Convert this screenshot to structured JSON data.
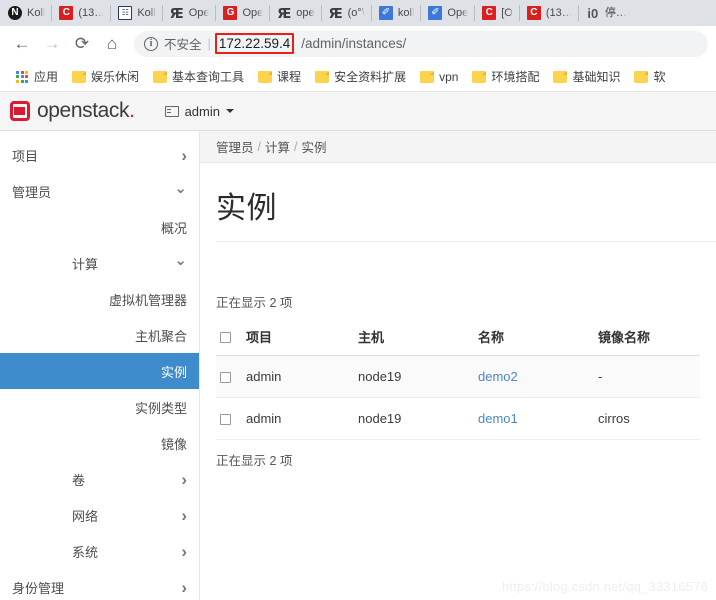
{
  "browser": {
    "tabs": [
      {
        "label": "Koll",
        "icon": "nav-circle-icon",
        "icon_style": "fav-n",
        "glyph": "N"
      },
      {
        "label": "(13…",
        "icon": "c-logo-icon",
        "icon_style": "fav-c",
        "glyph": "C"
      },
      {
        "label": "Koll",
        "icon": "book-icon",
        "icon_style": "fav-book",
        "glyph": "☷"
      },
      {
        "label": "Ope",
        "icon": "swirl-icon",
        "icon_style": "fav-sw",
        "glyph": "Ԙ"
      },
      {
        "label": "Ope",
        "icon": "g-logo-icon",
        "icon_style": "fav-g",
        "glyph": "G"
      },
      {
        "label": "ope",
        "icon": "swirl-icon",
        "icon_style": "fav-sw",
        "glyph": "Ԙ"
      },
      {
        "label": "(o°\\",
        "icon": "swirl-icon",
        "icon_style": "fav-sw",
        "glyph": "Ԙ"
      },
      {
        "label": "koll",
        "icon": "pen-icon",
        "icon_style": "fav-pen",
        "glyph": "✐"
      },
      {
        "label": "Ope",
        "icon": "pen-icon",
        "icon_style": "fav-pen",
        "glyph": "✐"
      },
      {
        "label": "[O",
        "icon": "c-logo-icon",
        "icon_style": "fav-c",
        "glyph": "C"
      },
      {
        "label": "(13…",
        "icon": "c-logo-icon",
        "icon_style": "fav-c",
        "glyph": "C"
      },
      {
        "label": "停…",
        "icon": "globe-icon",
        "icon_style": "fav-globe",
        "glyph": "ἱ0"
      }
    ],
    "toolbar": {
      "back_glyph": "←",
      "forward_glyph": "→",
      "reload_glyph": "⟳",
      "home_glyph": "⌂"
    },
    "omnibox": {
      "security_label": "不安全",
      "info_glyph": "i",
      "url_host": "172.22.59.4",
      "url_path": "/admin/instances/"
    },
    "bookmarks": [
      {
        "label": "应用",
        "icon": "apps-grid-icon"
      },
      {
        "label": "娱乐休闲",
        "icon": "folder-icon"
      },
      {
        "label": "基本查询工具",
        "icon": "folder-icon"
      },
      {
        "label": "课程",
        "icon": "folder-icon"
      },
      {
        "label": "安全资料扩展",
        "icon": "folder-icon"
      },
      {
        "label": "vpn",
        "icon": "folder-icon"
      },
      {
        "label": "环境搭配",
        "icon": "folder-icon"
      },
      {
        "label": "基础知识",
        "icon": "folder-icon"
      },
      {
        "label": "软",
        "icon": "folder-icon"
      }
    ]
  },
  "horizon": {
    "brand_name": "openstack",
    "brand_dot": ".",
    "context_label": "admin",
    "sidebar": [
      {
        "label": "项目",
        "level": 0,
        "chevron": "right",
        "active": false
      },
      {
        "label": "管理员",
        "level": 0,
        "chevron": "down",
        "active": false
      },
      {
        "label": "概况",
        "level": 2,
        "chevron": "none",
        "active": false
      },
      {
        "label": "计算",
        "level": 1,
        "chevron": "down",
        "active": false
      },
      {
        "label": "虚拟机管理器",
        "level": 2,
        "chevron": "none",
        "active": false
      },
      {
        "label": "主机聚合",
        "level": 2,
        "chevron": "none",
        "active": false
      },
      {
        "label": "实例",
        "level": 2,
        "chevron": "none",
        "active": true
      },
      {
        "label": "实例类型",
        "level": 2,
        "chevron": "none",
        "active": false
      },
      {
        "label": "镜像",
        "level": 2,
        "chevron": "none",
        "active": false
      },
      {
        "label": "卷",
        "level": 1,
        "chevron": "right",
        "active": false
      },
      {
        "label": "网络",
        "level": 1,
        "chevron": "right",
        "active": false
      },
      {
        "label": "系统",
        "level": 1,
        "chevron": "right",
        "active": false
      },
      {
        "label": "身份管理",
        "level": 0,
        "chevron": "right",
        "active": false
      }
    ],
    "breadcrumb": [
      "管理员",
      "计算",
      "实例"
    ],
    "breadcrumb_sep": "/",
    "page_title": "实例",
    "count_top": "正在显示 2 项",
    "count_bottom": "正在显示 2 项",
    "table": {
      "headers": [
        "项目",
        "主机",
        "名称",
        "镜像名称"
      ],
      "rows": [
        {
          "project": "admin",
          "host": "node19",
          "name": "demo2",
          "image": "-"
        },
        {
          "project": "admin",
          "host": "node19",
          "name": "demo1",
          "image": "cirros"
        }
      ]
    },
    "colors": {
      "active_nav": "#3f8ccc",
      "brand_red": "#da1a32",
      "link_blue": "#4a86c8",
      "url_highlight": "#e8201c"
    }
  },
  "watermark": "https://blog.csdn.net/qq_33316576"
}
